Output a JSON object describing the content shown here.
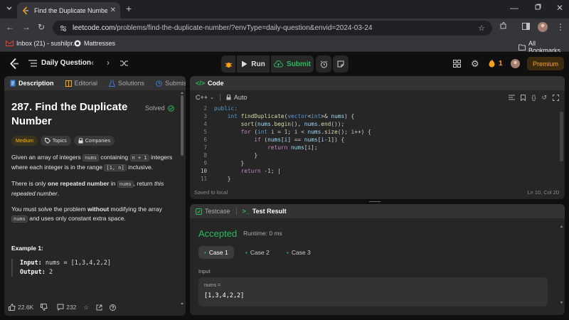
{
  "browser": {
    "tab_title": "Find the Duplicate Number - Le",
    "url_host": "leetcode.com",
    "url_path": "/problems/find-the-duplicate-number/?envType=daily-question&envid=2024-03-24",
    "bookmarks": [
      "Inbox (21) - sushilpr...",
      "Mattresses"
    ],
    "all_bookmarks": "All Bookmarks"
  },
  "header": {
    "title": "Daily Question",
    "run": "Run",
    "submit": "Submit",
    "streak": "1",
    "premium": "Premium"
  },
  "desc_tabs": [
    "Description",
    "Editorial",
    "Solutions",
    "Submission"
  ],
  "problem": {
    "title": "287. Find the Duplicate Number",
    "solved": "Solved",
    "chips": [
      "Medium",
      "Topics",
      "Companies"
    ],
    "p1_a": "Given an array of integers ",
    "p1_b": "nums",
    "p1_c": " containing ",
    "p1_d": "n + 1",
    "p1_e": " integers where each integer is in the range ",
    "p1_f": "[1, n]",
    "p1_g": " inclusive.",
    "p2_a": "There is only ",
    "p2_b": "one repeated number",
    "p2_c": " in ",
    "p2_d": "nums",
    "p2_e": ", return ",
    "p2_f": "this repeated number",
    "p2_g": ".",
    "p3_a": "You must solve the problem ",
    "p3_b": "without",
    "p3_c": " modifying the array ",
    "p3_d": "nums",
    "p3_e": " and uses only constant extra space.",
    "example_title": "Example 1:",
    "ex_input_label": "Input:",
    "ex_input": " nums = [1,3,4,2,2]",
    "ex_output_label": "Output:",
    "ex_output": " 2"
  },
  "footer": {
    "likes": "22.6K",
    "comments": "232"
  },
  "code_panel": {
    "title": "Code",
    "language": "C++",
    "mode": "Auto",
    "saved": "Saved to local",
    "cursor": "Ln 10, Col 20",
    "line_numbers": [
      "2",
      "3",
      "4",
      "5",
      "6",
      "7",
      "8",
      "9",
      "10",
      "11"
    ]
  },
  "result_panel": {
    "tabs": [
      "Testcase",
      "Test Result"
    ],
    "status": "Accepted",
    "runtime": "Runtime: 0 ms",
    "cases": [
      "Case 1",
      "Case 2",
      "Case 3"
    ],
    "input_label": "Input",
    "var_name": "nums =",
    "var_value": "[1,3,4,2,2]"
  },
  "colors": {
    "accent": "#ffa116",
    "success": "#2cbb5d",
    "panel": "#262626"
  }
}
